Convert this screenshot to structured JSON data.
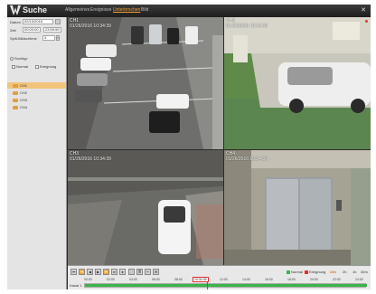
{
  "app": {
    "title": "Suche",
    "close_icon": "close-icon",
    "nav": [
      "Allgemeines",
      "Ereignisse",
      "Unterbrochen",
      "Bild"
    ]
  },
  "left": {
    "date_label": "Datum",
    "date_value": "02/13/2016",
    "time_label": "Zeit",
    "time_from": "00:00:00",
    "time_to": "23:59:59",
    "split_label": "Split-Bildschirme",
    "split_value": "4",
    "search_label": "Suchtyp",
    "normal_label": "Normal",
    "event_label": "Ereignung",
    "channels": [
      "CH1",
      "CH2",
      "CH3",
      "CH4"
    ]
  },
  "cams": [
    {
      "name": "CH1",
      "time": "01/26/2016 10:34:39"
    },
    {
      "name": "CH2",
      "time": "01/26/2016 10:34:39"
    },
    {
      "name": "CH3",
      "time": "01/26/2016 10:34:39"
    },
    {
      "name": "CH4",
      "time": "01/26/2016 10:34:39"
    }
  ],
  "controls": {
    "buttons": [
      "⏮",
      "⏪",
      "◀",
      "▶",
      "⏩",
      "⏭",
      "⏹",
      "⛶",
      "≣",
      "✂",
      "⊞"
    ],
    "legend_normal": "Normal",
    "legend_event": "Ereignung",
    "legend_normal_color": "#3bb54a",
    "legend_event_color": "#e03030",
    "zooms": [
      "24h",
      "2h",
      "1h",
      "30m"
    ],
    "active_zoom": "24h",
    "ticks": [
      "00:00",
      "02:00",
      "04:00",
      "06:00",
      "08:00",
      "10:00",
      "12:00",
      "14:00",
      "16:00",
      "18:00",
      "20:00",
      "22:00",
      "24:00"
    ],
    "track_label": "Kanal 1",
    "cursor_time": "10:34:39"
  }
}
